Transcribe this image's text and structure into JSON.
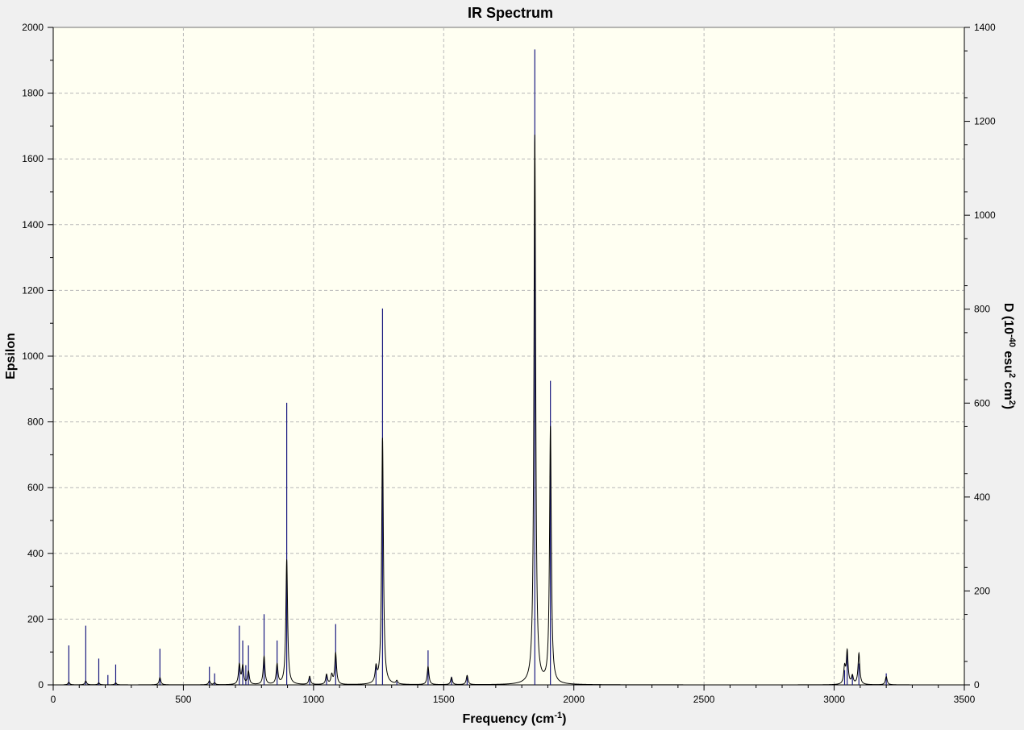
{
  "chart_data": {
    "type": "line",
    "title": "IR Spectrum",
    "xlabel": {
      "main": "Frequency (cm",
      "sup": "-1",
      "end": ")"
    },
    "ylabel": "Epsilon",
    "y2label": {
      "p1": "D (10",
      "s1": "-40",
      "p2": " esu",
      "s2": "2",
      "p3": " cm",
      "s3": "2",
      "p4": ")"
    },
    "xlim": [
      0,
      3500
    ],
    "ylim": [
      0,
      2000
    ],
    "y2lim": [
      0,
      1400
    ],
    "x_ticks": [
      "0",
      "500",
      "1000",
      "1500",
      "2000",
      "2500",
      "3000",
      "3500"
    ],
    "y_ticks": [
      "0",
      "200",
      "400",
      "600",
      "800",
      "1000",
      "1200",
      "1400",
      "1600",
      "1800",
      "2000"
    ],
    "y2_ticks": [
      "0",
      "200",
      "400",
      "600",
      "800",
      "1000",
      "1200",
      "1400"
    ],
    "grid": true,
    "colors": {
      "plot_background": "#fffff2",
      "stick": "#1a1a80",
      "curve": "#000000",
      "window": "#f0f0f0"
    },
    "series": [
      {
        "type": "stick",
        "x": [
          60,
          125,
          175,
          210,
          240,
          410,
          600,
          620,
          715,
          728,
          740,
          750,
          810,
          860,
          897,
          985,
          1050,
          1085,
          1240,
          1265,
          1320,
          1440,
          1530,
          1590,
          1850,
          1910,
          3040,
          3050,
          3070,
          3095,
          3200
        ],
        "y": [
          120,
          180,
          80,
          30,
          62,
          110,
          55,
          35,
          180,
          135,
          60,
          120,
          215,
          135,
          858,
          20,
          30,
          185,
          60,
          1145,
          10,
          105,
          25,
          25,
          1933,
          925,
          45,
          95,
          30,
          65,
          35
        ]
      },
      {
        "type": "curve",
        "hwhm": 4,
        "baseline_start": 40,
        "baseline_end": 3290,
        "peaks": [
          {
            "x": 60,
            "h": 8
          },
          {
            "x": 125,
            "h": 12
          },
          {
            "x": 175,
            "h": 6
          },
          {
            "x": 240,
            "h": 6
          },
          {
            "x": 410,
            "h": 22
          },
          {
            "x": 600,
            "h": 12
          },
          {
            "x": 620,
            "h": 6
          },
          {
            "x": 715,
            "h": 60
          },
          {
            "x": 728,
            "h": 55
          },
          {
            "x": 750,
            "h": 40
          },
          {
            "x": 810,
            "h": 85
          },
          {
            "x": 860,
            "h": 60
          },
          {
            "x": 897,
            "h": 380
          },
          {
            "x": 985,
            "h": 25
          },
          {
            "x": 1050,
            "h": 30
          },
          {
            "x": 1070,
            "h": 28
          },
          {
            "x": 1085,
            "h": 95
          },
          {
            "x": 1240,
            "h": 45
          },
          {
            "x": 1265,
            "h": 750
          },
          {
            "x": 1320,
            "h": 10
          },
          {
            "x": 1440,
            "h": 55
          },
          {
            "x": 1530,
            "h": 22
          },
          {
            "x": 1590,
            "h": 28
          },
          {
            "x": 1850,
            "h": 1670
          },
          {
            "x": 1910,
            "h": 780
          },
          {
            "x": 3040,
            "h": 50
          },
          {
            "x": 3050,
            "h": 100
          },
          {
            "x": 3070,
            "h": 25
          },
          {
            "x": 3095,
            "h": 95
          },
          {
            "x": 3200,
            "h": 25
          }
        ]
      }
    ]
  }
}
